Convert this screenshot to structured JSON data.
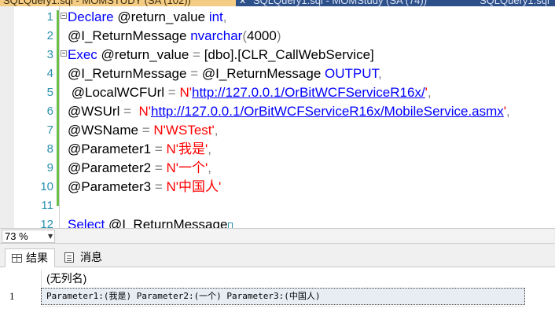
{
  "tabs": {
    "tab1_title": "SQLQuery1.sql - MOMSTUDY (SA (102))",
    "tab1_close": "✕",
    "tab2_title": "SQLQuery1.sql - MOMStudy (SA (74))",
    "tab3_title": "SQLQuery1.sql"
  },
  "editor": {
    "line_numbers": [
      "1",
      "2",
      "3",
      "4",
      "5",
      "6",
      "7",
      "8",
      "9",
      "10",
      "11",
      "12"
    ],
    "lines": {
      "l1": {
        "kw1": "Declare",
        "dots1": " ",
        "var": "@return_value",
        "dots2": " ",
        "kw2": "int",
        "op": ","
      },
      "l2": {
        "var": "@I_ReturnMessage",
        "dots1": " ",
        "kw": "nvarchar",
        "op1": "(",
        "num": "4000",
        "op2": ")"
      },
      "l3": {
        "kw": "Exec",
        "dots1": " ",
        "var": "@return_value",
        "dots2": " ",
        "op": "=",
        "dots3": " ",
        "obj": "[dbo].[CLR_CallWebService]"
      },
      "l4": {
        "var": "@I_ReturnMessage",
        "dots1": " ",
        "op": "=",
        "dots2": " ",
        "var2": "@I_ReturnMessage",
        "dots3": " ",
        "kw": "OUTPUT",
        "comma": ","
      },
      "l5": {
        "dots0": " ",
        "var": "@LocalWCFUrl",
        "dots1": " ",
        "op": "=",
        "dots2": " ",
        "str_pre": "N'",
        "url": "http://127.0.0.1/OrBitWCFServiceR16x/",
        "str_post": "'",
        "comma": ","
      },
      "l6": {
        "var": "@WSUrl",
        "dots1": " ",
        "op": "=",
        "dots2": "  ",
        "str_pre": "N'",
        "url": "http://127.0.0.1/OrBitWCFServiceR16x/MobileService.asmx",
        "str_post": "'",
        "comma": ","
      },
      "l7": {
        "var": "@WSName",
        "dots1": " ",
        "op": "=",
        "dots2": " ",
        "str": "N'WSTest'",
        "comma": ","
      },
      "l8": {
        "var": "@Parameter1",
        "dots1": " ",
        "op": "=",
        "dots2": " ",
        "str": "N'我是'",
        "comma": ","
      },
      "l9": {
        "var": "@Parameter2",
        "dots1": " ",
        "op": "=",
        "dots2": " ",
        "str": "N'一个'",
        "comma": ","
      },
      "l10": {
        "var": "@Parameter3",
        "dots1": " ",
        "op": "=",
        "dots2": " ",
        "str": "N'中国人'"
      },
      "l12": {
        "kw": "Select",
        "dots1": " ",
        "var": "@I_ReturnMessage"
      }
    }
  },
  "statusbar": {
    "zoom": "73 %",
    "zoom_arrow": "▼"
  },
  "result_tabs": {
    "results_label": "结果",
    "messages_label": "消息"
  },
  "results": {
    "column_header": "(无列名)",
    "rows": [
      {
        "num": "1",
        "value": "Parameter1:(我是) Parameter2:(一个) Parameter3:(中国人)"
      }
    ]
  },
  "colors": {
    "keyword": "#0000ff",
    "string": "#ff0000",
    "line_number": "#2b91af",
    "change_bar": "#6abf4b",
    "tab_active": "#f5cc84",
    "tab_strip": "#2d4f8a"
  }
}
